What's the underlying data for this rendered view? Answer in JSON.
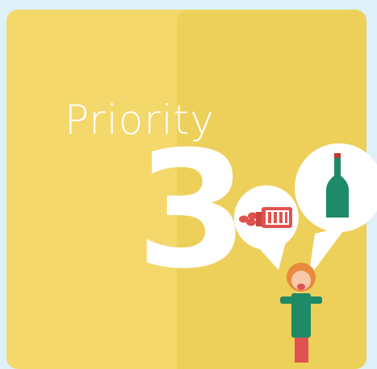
{
  "title": "Priority",
  "number": "3",
  "colors": {
    "background": "#def1f8",
    "card_left": "#f4d86b",
    "card_right": "#ecd05a",
    "text": "#ffffff",
    "bottle": "#1f8a6a",
    "pills": "#e0524f",
    "person_shirt": "#1e8a66",
    "person_hair": "#e88a3c"
  },
  "icons": [
    "pills-icon",
    "pill-box-icon",
    "bottle-icon",
    "person-icon"
  ]
}
